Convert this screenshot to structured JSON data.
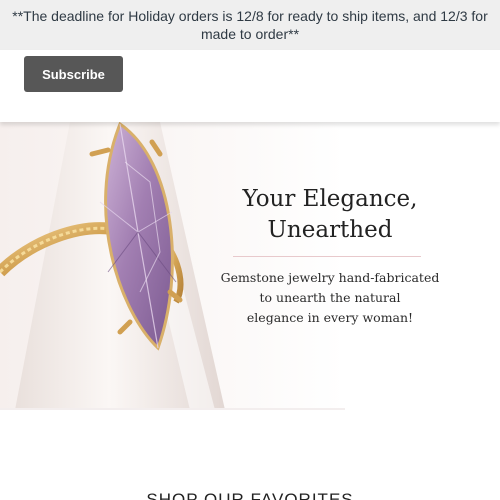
{
  "announcement": {
    "text": "**The deadline for Holiday orders is 12/8 for ready to ship items, and 12/3 for made to order**"
  },
  "subscribe": {
    "button_label": "Subscribe"
  },
  "hero": {
    "heading_line1": "Your Elegance,",
    "heading_line2": "Unearthed",
    "subtext_line1": "Gemstone jewelry hand-fabricated",
    "subtext_line2": "to unearth the natural",
    "subtext_line3": "elegance in every woman!",
    "image_icon": "amethyst-ring-photo"
  },
  "favorites": {
    "heading": "SHOP OUR FAVORITES"
  },
  "colors": {
    "announcement_bg": "#efefef",
    "button_bg": "#575757",
    "divider": "#e8c9cc",
    "amethyst": "#a57fb3",
    "gold": "#d6a85a"
  }
}
